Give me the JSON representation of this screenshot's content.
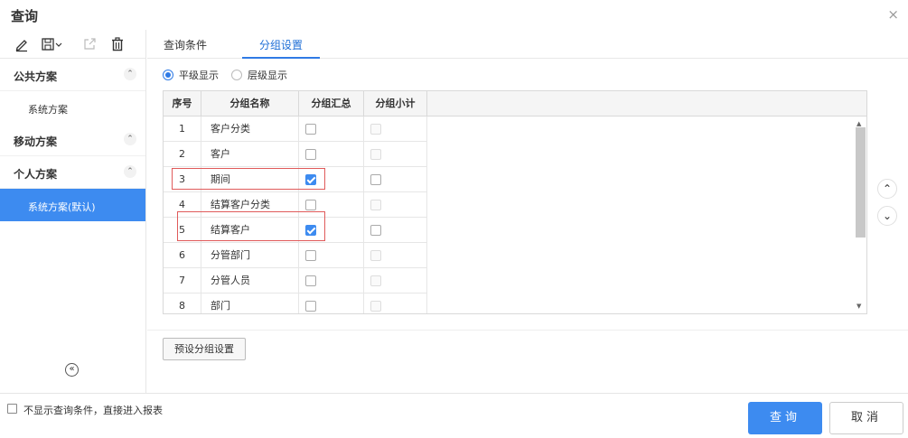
{
  "dialog": {
    "title": "查询",
    "close_glyph": "×"
  },
  "toolbar": {
    "edit_icon": "pencil-icon",
    "save_icon": "save-dropdown-icon",
    "export_icon": "export-icon",
    "delete_icon": "trash-icon"
  },
  "sidebar": {
    "groups": [
      {
        "label": "公共方案",
        "items": [
          "系统方案"
        ]
      },
      {
        "label": "移动方案",
        "items": []
      },
      {
        "label": "个人方案",
        "items": [
          "系统方案(默认)"
        ]
      }
    ],
    "active_item": "系统方案(默认)",
    "chevron_glyph": "⌃",
    "collapse_glyph": "«"
  },
  "tabs": [
    {
      "label": "查询条件"
    },
    {
      "label": "分组设置",
      "active": true
    }
  ],
  "radio": {
    "options": [
      "平级显示",
      "层级显示"
    ],
    "selected": "平级显示"
  },
  "grid": {
    "columns": [
      "序号",
      "分组名称",
      "分组汇总",
      "分组小计"
    ],
    "rows": [
      {
        "seq": "1",
        "name": "客户分类",
        "sum": false,
        "sub": false,
        "sub_disabled": true
      },
      {
        "seq": "2",
        "name": "客户",
        "sum": false,
        "sub": false,
        "sub_disabled": true
      },
      {
        "seq": "3",
        "name": "期间",
        "sum": true,
        "sub": false,
        "sub_disabled": false
      },
      {
        "seq": "4",
        "name": "结算客户分类",
        "sum": false,
        "sub": false,
        "sub_disabled": true
      },
      {
        "seq": "5",
        "name": "结算客户",
        "sum": true,
        "sub": false,
        "sub_disabled": false
      },
      {
        "seq": "6",
        "name": "分管部门",
        "sum": false,
        "sub": false,
        "sub_disabled": true
      },
      {
        "seq": "7",
        "name": "分管人员",
        "sum": false,
        "sub": false,
        "sub_disabled": true
      },
      {
        "seq": "8",
        "name": "部门",
        "sum": false,
        "sub": false,
        "sub_disabled": true
      }
    ],
    "scroll_up_glyph": "▲",
    "scroll_down_glyph": "▼"
  },
  "move": {
    "up_glyph": "⌃",
    "down_glyph": "⌄"
  },
  "preset_button": "预设分组设置",
  "footer": {
    "skip_label": "不显示查询条件，直接进入报表",
    "query_label": "查询",
    "cancel_label": "取消"
  },
  "colors": {
    "accent": "#3d8bf0",
    "highlight_border": "#e05a5a"
  }
}
